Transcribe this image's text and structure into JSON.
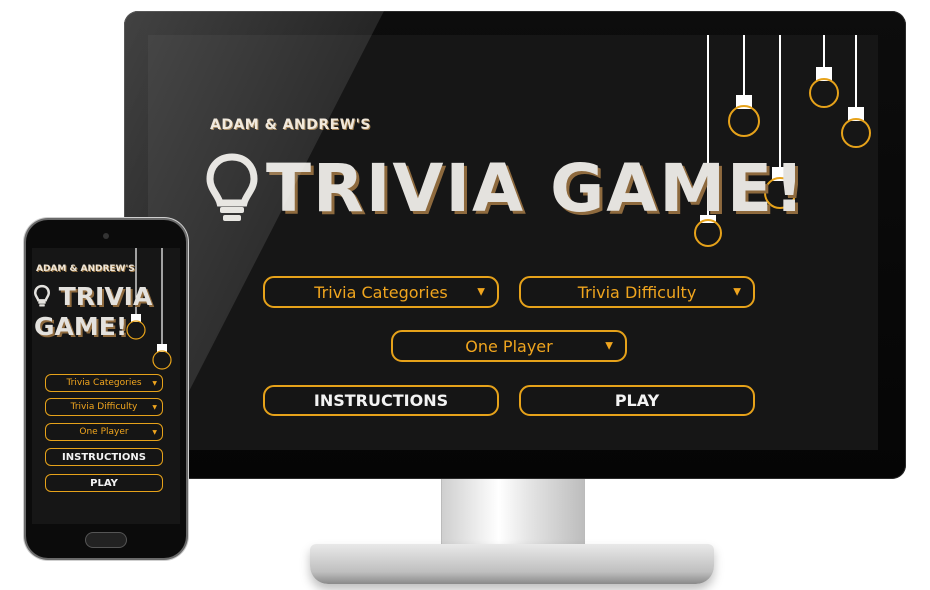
{
  "desktop": {
    "subtitle": "ADAM & ANDREW'S",
    "title": "TRIVIA GAME!",
    "categories_select": "Trivia Categories",
    "difficulty_select": "Trivia Difficulty",
    "players_select": "One Player",
    "instructions_button": "INSTRUCTIONS",
    "play_button": "PLAY"
  },
  "mobile": {
    "subtitle": "ADAM & ANDREW'S",
    "title": "TRIVIA GAME!",
    "categories_select": "Trivia Categories",
    "difficulty_select": "Trivia Difficulty",
    "players_select": "One Player",
    "instructions_button": "INSTRUCTIONS",
    "play_button": "PLAY"
  },
  "icons": {
    "dropdown": "chevron-down-icon",
    "logo": "lightbulb-icon",
    "decoration": "hanging-bulb-icon"
  },
  "colors": {
    "accent": "#f0a51e",
    "background": "#161616",
    "title": "#e4e2de",
    "title_shadow": "#8e6a3e"
  }
}
